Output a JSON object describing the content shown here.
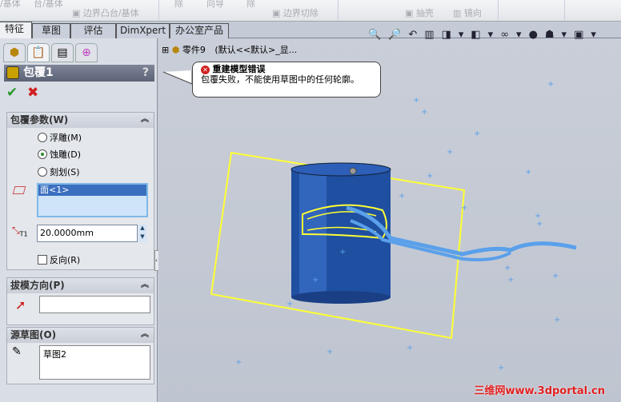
{
  "toolbar": {
    "items": [
      "/基体",
      "台/基体",
      "边界凸台/基体",
      "除",
      "向导",
      "除",
      "边界切除",
      "抽壳",
      "镜向"
    ]
  },
  "tabs": [
    {
      "label": "特征",
      "active": true
    },
    {
      "label": "草图"
    },
    {
      "label": "评估"
    },
    {
      "label": "DimXpert"
    },
    {
      "label": "办公室产品"
    }
  ],
  "tree": {
    "part": "零件9",
    "config": "(默认<<默认>_显..."
  },
  "error": {
    "title": "重建模型错误",
    "message": "包覆失败，不能使用草图中的任何轮廓。"
  },
  "feature": {
    "title": "包覆1",
    "help": "?"
  },
  "params": {
    "header": "包覆参数(W)",
    "options": [
      {
        "label": "浮雕(M)",
        "selected": false
      },
      {
        "label": "蚀雕(D)",
        "selected": true
      },
      {
        "label": "刻划(S)",
        "selected": false
      }
    ],
    "face": "面<1>",
    "thickness": "20.0000mm",
    "reverse": "反向(R)",
    "reverse_checked": false
  },
  "draft": {
    "header": "拔模方向(P)",
    "value": ""
  },
  "source": {
    "header": "源草图(O)",
    "value": "草图2"
  },
  "watermark": "三维网www.3dportal.cn",
  "colors": {
    "accent": "#ffff33",
    "model": "#1f4fa0",
    "sketch": "#5aa0ea"
  }
}
